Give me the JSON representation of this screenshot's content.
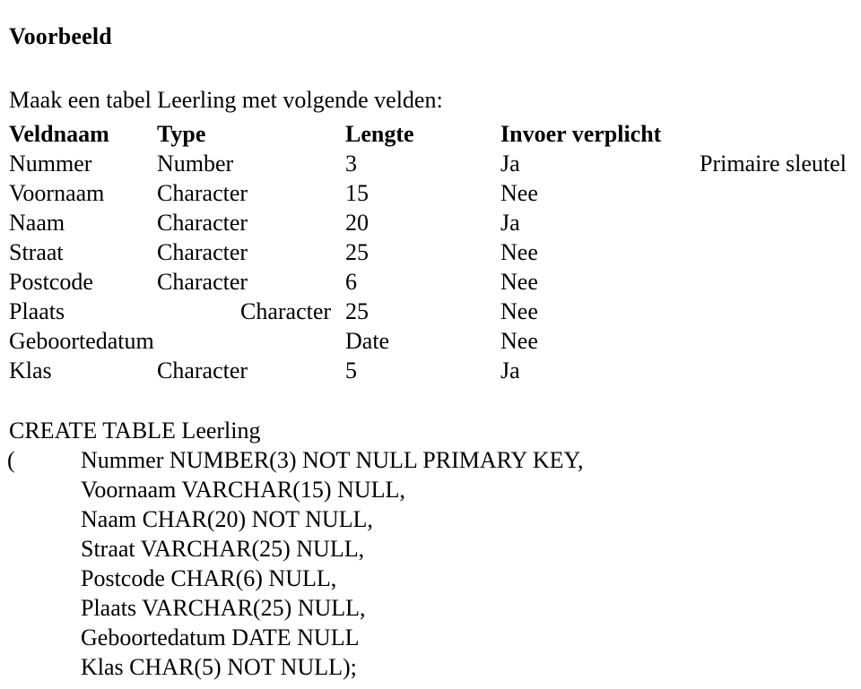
{
  "document": {
    "title": "Voorbeeld",
    "intro": "Maak een tabel Leerling met volgende velden:"
  },
  "spec_table": {
    "headers": {
      "veldnaam": "Veldnaam",
      "type": "Type",
      "lengte": "Lengte",
      "invoer": "Invoer verplicht"
    },
    "rows": [
      {
        "veldnaam": "Nummer",
        "type": "Number",
        "lengte": "3",
        "invoer": "Ja",
        "note": "Primaire sleutel"
      },
      {
        "veldnaam": "Voornaam",
        "type": "Character",
        "lengte": "15",
        "invoer": "Nee",
        "note": ""
      },
      {
        "veldnaam": "Naam",
        "type": "Character",
        "lengte": "20",
        "invoer": "Ja",
        "note": ""
      },
      {
        "veldnaam": "Straat",
        "type": "Character",
        "lengte": "25",
        "invoer": "Nee",
        "note": ""
      },
      {
        "veldnaam": "Postcode",
        "type": "Character",
        "lengte": "6",
        "invoer": "Nee",
        "note": ""
      },
      {
        "veldnaam": "Plaats",
        "type": "Character",
        "lengte": "25",
        "invoer": "Nee",
        "note": ""
      },
      {
        "veldnaam": "Geboortedatum",
        "type": "Date",
        "lengte": "",
        "invoer": "Nee",
        "note": ""
      },
      {
        "veldnaam": "Klas",
        "type": "Character",
        "lengte": "5",
        "invoer": "Ja",
        "note": ""
      }
    ]
  },
  "sql": {
    "statement_head": "CREATE TABLE Leerling",
    "open_paren": "(",
    "lines": [
      "Nummer NUMBER(3) NOT NULL PRIMARY KEY,",
      "Voornaam VARCHAR(15) NULL,",
      "Naam CHAR(20) NOT NULL,",
      "Straat VARCHAR(25) NULL,",
      "Postcode CHAR(6) NULL,",
      "Plaats VARCHAR(25) NULL,",
      "Geboortedatum DATE NULL",
      "Klas CHAR(5) NOT NULL);"
    ]
  },
  "colors": {
    "text": "#000000",
    "background": "#ffffff"
  }
}
